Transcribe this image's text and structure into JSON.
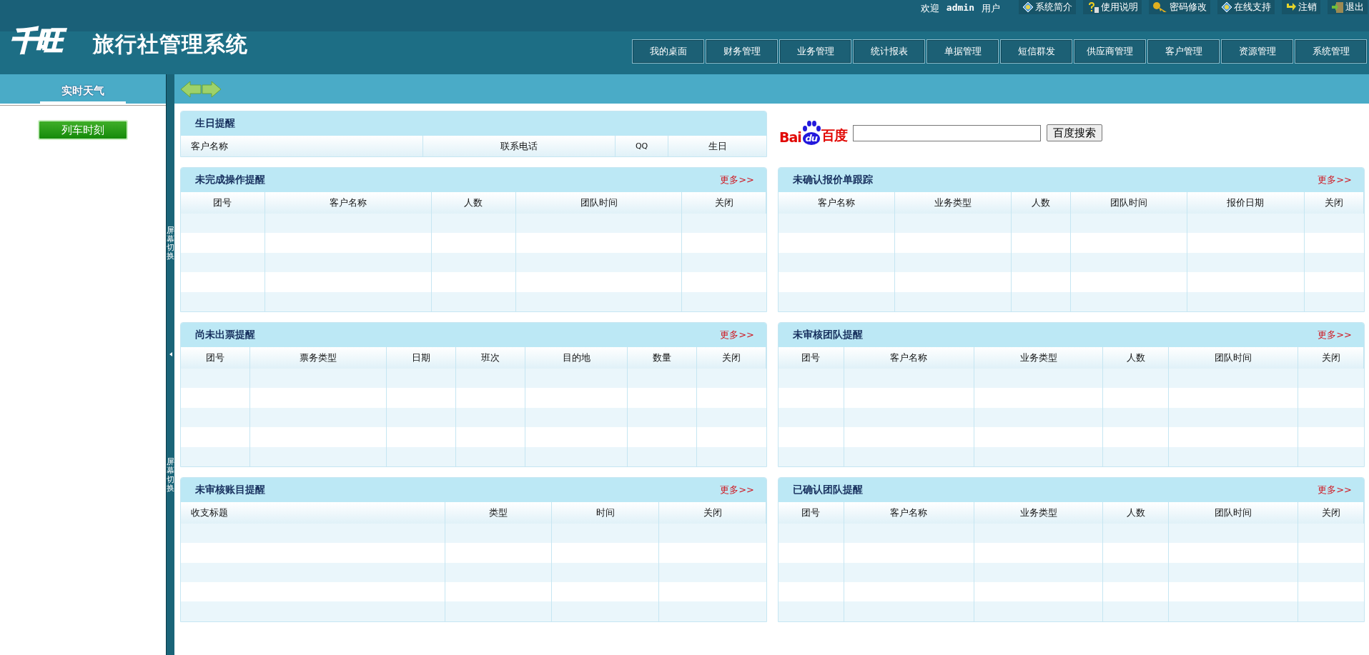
{
  "top_bar": {
    "welcome": "欢迎",
    "user": "admin",
    "role": "用户",
    "links": [
      {
        "label": "系统简介",
        "kind": "diamond"
      },
      {
        "label": "使用说明",
        "kind": "help"
      },
      {
        "label": "密码修改",
        "kind": "key"
      },
      {
        "label": "在线支持",
        "kind": "diamond"
      },
      {
        "label": "注销",
        "kind": "arrow"
      },
      {
        "label": "退出",
        "kind": "door"
      }
    ]
  },
  "logo": {
    "mark": "千旺",
    "title": "旅行社管理系统"
  },
  "nav": [
    "我的桌面",
    "财务管理",
    "业务管理",
    "统计报表",
    "单据管理",
    "短信群发",
    "供应商管理",
    "客户管理",
    "资源管理",
    "系统管理"
  ],
  "sidebar": {
    "title": "实时天气",
    "button": "列车时刻"
  },
  "splitter": {
    "labels": [
      "屏幕切换",
      "屏幕切换"
    ]
  },
  "birthday": {
    "title": "生日提醒",
    "columns": [
      "客户名称",
      "联系电话",
      "QQ",
      "生日"
    ]
  },
  "baidu": {
    "logo": [
      "Bai",
      "du",
      "百度"
    ],
    "button": "百度搜索"
  },
  "panels": [
    {
      "title": "未完成操作提醒",
      "more": "更多>>",
      "columns": [
        "团号",
        "客户名称",
        "人数",
        "团队时间",
        "关闭"
      ]
    },
    {
      "title": "未确认报价单跟踪",
      "more": "更多>>",
      "columns": [
        "客户名称",
        "业务类型",
        "人数",
        "团队时间",
        "报价日期",
        "关闭"
      ]
    },
    {
      "title": "尚未出票提醒",
      "more": "更多>>",
      "columns": [
        "团号",
        "票务类型",
        "日期",
        "班次",
        "目的地",
        "数量",
        "关闭"
      ]
    },
    {
      "title": "未审核团队提醒",
      "more": "更多>>",
      "columns": [
        "团号",
        "客户名称",
        "业务类型",
        "人数",
        "团队时间",
        "关闭"
      ]
    },
    {
      "title": "未审核账目提醒",
      "more": "更多>>",
      "columns": [
        "收支标题",
        "类型",
        "时间",
        "关闭"
      ]
    },
    {
      "title": "已确认团队提醒",
      "more": "更多>>",
      "columns": [
        "团号",
        "客户名称",
        "业务类型",
        "人数",
        "团队时间",
        "关闭"
      ]
    }
  ]
}
